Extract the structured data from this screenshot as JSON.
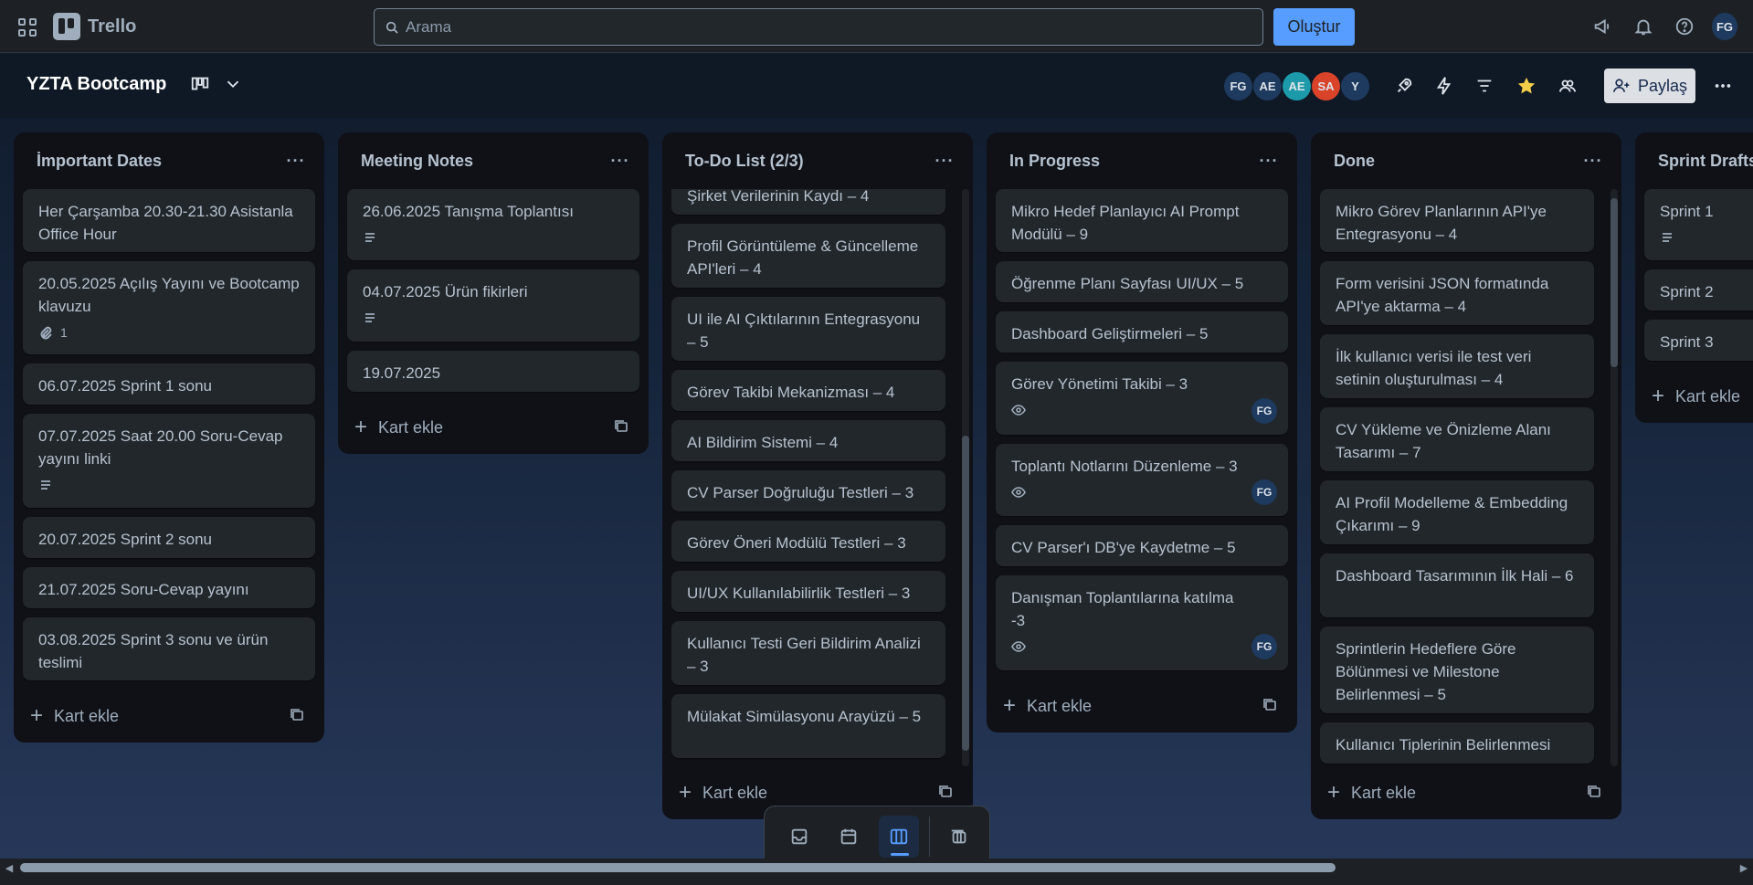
{
  "topbar": {
    "app_name": "Trello",
    "search_placeholder": "Arama",
    "create_label": "Oluştur",
    "user_initials": "FG"
  },
  "board": {
    "title": "YZTA Bootcamp",
    "members": [
      {
        "initials": "FG",
        "color": "#1e3a5f"
      },
      {
        "initials": "AE",
        "color": "#1e3a5f"
      },
      {
        "initials": "AE",
        "color": "#1d9aaa"
      },
      {
        "initials": "SA",
        "color": "#d8432a"
      },
      {
        "initials": "Y",
        "color": "#1e3a5f"
      }
    ],
    "share_label": "Paylaş",
    "star_color": "#f5cd47"
  },
  "lists": [
    {
      "title": "İmportant Dates",
      "cards": [
        {
          "text": "Her Çarşamba 20.30-21.30 Asistanla Office Hour"
        },
        {
          "text": "20.05.2025 Açılış Yayını ve Bootcamp klavuzu",
          "attachments": "1"
        },
        {
          "text": "06.07.2025 Sprint 1 sonu"
        },
        {
          "text": "07.07.2025 Saat 20.00 Soru-Cevap yayını linki",
          "description": true
        },
        {
          "text": "20.07.2025 Sprint 2 sonu"
        },
        {
          "text": "21.07.2025 Soru-Cevap yayını"
        },
        {
          "text": "03.08.2025 Sprint 3 sonu ve ürün teslimi"
        }
      ],
      "add_label": "Kart ekle"
    },
    {
      "title": "Meeting Notes",
      "cards": [
        {
          "text": "26.06.2025 Tanışma Toplantısı",
          "description": true
        },
        {
          "text": "04.07.2025 Ürün fikirleri",
          "description": true
        },
        {
          "text": "19.07.2025"
        }
      ],
      "add_label": "Kart ekle"
    },
    {
      "title": "To-Do List (2/3)",
      "cards": [
        {
          "text": "Şirket Verilerinin Kaydı – 4"
        },
        {
          "text": "Profil Görüntüleme & Güncelleme API'leri – 4"
        },
        {
          "text": "UI ile AI Çıktılarının Entegrasyonu – 5"
        },
        {
          "text": "Görev Takibi Mekanizması – 4"
        },
        {
          "text": "AI Bildirim Sistemi – 4"
        },
        {
          "text": "CV Parser Doğruluğu Testleri – 3"
        },
        {
          "text": "Görev Öneri Modülü Testleri – 3"
        },
        {
          "text": "UI/UX Kullanılabilirlik Testleri – 3"
        },
        {
          "text": "Kullanıcı Testi Geri Bildirim Analizi – 3"
        },
        {
          "text": "Mülakat Simülasyonu Arayüzü – 5"
        }
      ],
      "add_label": "Kart ekle"
    },
    {
      "title": "In Progress",
      "cards": [
        {
          "text": "Mikro Hedef Planlayıcı AI Prompt Modülü – 9"
        },
        {
          "text": "Öğrenme Planı Sayfası UI/UX – 5"
        },
        {
          "text": "Dashboard Geliştirmeleri – 5"
        },
        {
          "text": "Görev Yönetimi Takibi – 3",
          "watch": true,
          "member": "FG"
        },
        {
          "text": "Toplantı Notlarını Düzenleme – 3",
          "watch": true,
          "member": "FG"
        },
        {
          "text": "CV Parser'ı DB'ye Kaydetme – 5"
        },
        {
          "text": "Danışman Toplantılarına katılma -3",
          "watch": true,
          "member": "FG"
        }
      ],
      "add_label": "Kart ekle"
    },
    {
      "title": "Done",
      "cards": [
        {
          "text": "Mikro Görev Planlarının API'ye Entegrasyonu – 4"
        },
        {
          "text": "Form verisini JSON formatında API'ye aktarma – 4"
        },
        {
          "text": "İlk kullanıcı verisi ile test veri setinin oluşturulması – 4"
        },
        {
          "text": "CV Yükleme ve Önizleme Alanı Tasarımı – 7"
        },
        {
          "text": "AI Profil Modelleme & Embedding Çıkarımı – 9"
        },
        {
          "text": "Dashboard Tasarımının İlk Hali – 6"
        },
        {
          "text": "Sprintlerin Hedeflere Göre Bölünmesi ve Milestone Belirlenmesi – 5"
        },
        {
          "text": "Kullanıcı Tiplerinin Belirlenmesi"
        }
      ],
      "add_label": "Kart ekle"
    },
    {
      "title": "Sprint Drafts",
      "cards": [
        {
          "text": "Sprint 1",
          "description": true
        },
        {
          "text": "Sprint 2"
        },
        {
          "text": "Sprint 3"
        }
      ],
      "add_label": "Kart ekle"
    }
  ],
  "bottom_switcher": {
    "items": [
      "inbox-icon",
      "calendar-icon",
      "board-icon",
      "switch-boards-icon"
    ],
    "active": "board-icon"
  }
}
